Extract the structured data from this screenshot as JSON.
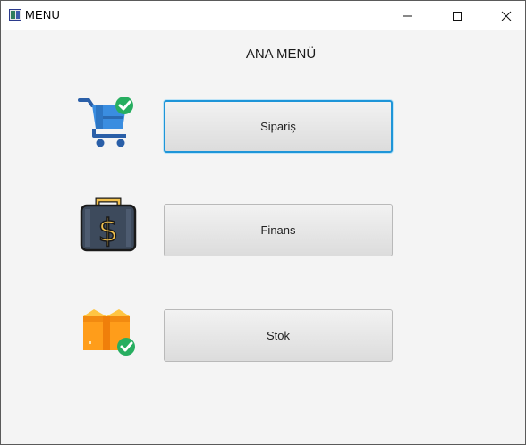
{
  "window": {
    "title": "MENU",
    "controls": {
      "minimize": "—",
      "maximize": "☐",
      "close": "✕"
    }
  },
  "main": {
    "heading": "ANA MENÜ",
    "buttons": [
      {
        "label": "Sipariş",
        "icon": "shopping-cart-check-icon",
        "focused": true
      },
      {
        "label": "Finans",
        "icon": "money-briefcase-icon",
        "focused": false
      },
      {
        "label": "Stok",
        "icon": "box-check-icon",
        "focused": false
      }
    ]
  },
  "colors": {
    "focus_border": "#1e95d8",
    "background": "#f4f4f4",
    "check_green": "#27ae60"
  }
}
